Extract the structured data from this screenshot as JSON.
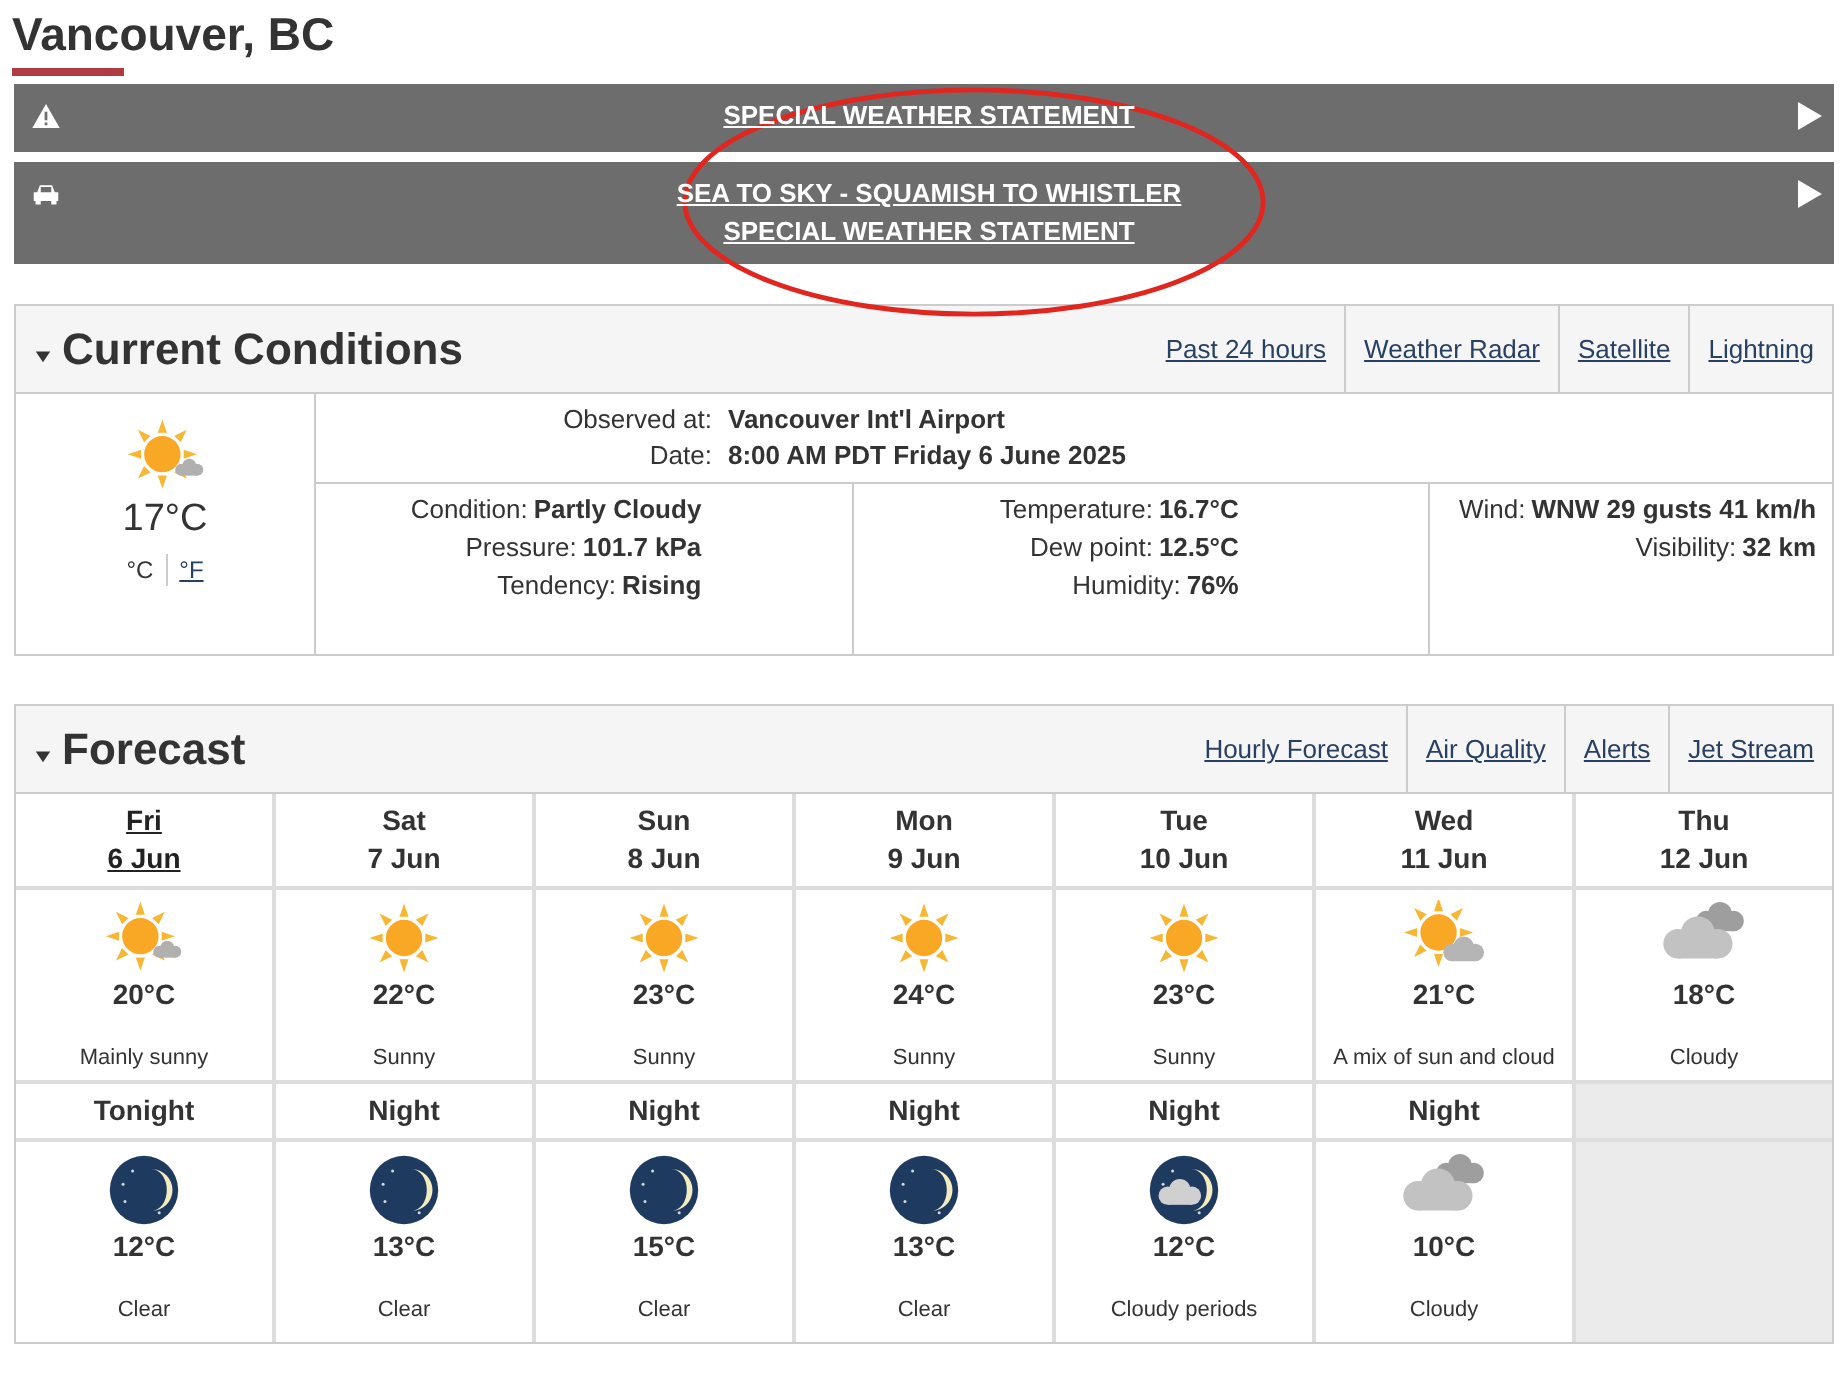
{
  "page_title": "Vancouver, BC",
  "alerts": [
    {
      "kind": "warning",
      "lines": [
        "SPECIAL WEATHER STATEMENT"
      ]
    },
    {
      "kind": "car",
      "lines": [
        "SEA TO SKY - SQUAMISH TO WHISTLER",
        "SPECIAL WEATHER STATEMENT"
      ]
    }
  ],
  "annotation": {
    "kind": "ellipse"
  },
  "current_conditions": {
    "title": "Current Conditions",
    "links": [
      "Past 24 hours",
      "Weather Radar",
      "Satellite",
      "Lightning"
    ],
    "kind": "mainly-sunny",
    "temperature": "17°C",
    "units": [
      {
        "label": "°C",
        "selected": true
      },
      {
        "label": "°F",
        "selected": false
      }
    ],
    "observation": [
      {
        "label": "Observed at:",
        "value": "Vancouver Int'l Airport"
      },
      {
        "label": "Date:",
        "value": "8:00 AM PDT Friday 6 June 2025"
      }
    ],
    "columns": [
      [
        {
          "label": "Condition:",
          "value": "Partly Cloudy"
        },
        {
          "label": "Pressure:",
          "value": "101.7 kPa"
        },
        {
          "label": "Tendency:",
          "value": "Rising"
        }
      ],
      [
        {
          "label": "Temperature:",
          "value": "16.7°C"
        },
        {
          "label": "Dew point:",
          "value": "12.5°C"
        },
        {
          "label": "Humidity:",
          "value": "76%"
        }
      ],
      [
        {
          "label": "Wind:",
          "value": "WNW 29 gusts 41 km/h"
        },
        {
          "label": "Visibility:",
          "value": "32 km"
        }
      ]
    ]
  },
  "forecast": {
    "title": "Forecast",
    "links": [
      "Hourly Forecast",
      "Air Quality",
      "Alerts",
      "Jet Stream"
    ],
    "days": [
      {
        "day": "Fri",
        "date": "6 Jun",
        "selected": true,
        "kind": "mainly-sunny",
        "temperature": "20°C",
        "summary": "Mainly sunny"
      },
      {
        "day": "Sat",
        "date": "7 Jun",
        "selected": false,
        "kind": "sunny",
        "temperature": "22°C",
        "summary": "Sunny"
      },
      {
        "day": "Sun",
        "date": "8 Jun",
        "selected": false,
        "kind": "sunny",
        "temperature": "23°C",
        "summary": "Sunny"
      },
      {
        "day": "Mon",
        "date": "9 Jun",
        "selected": false,
        "kind": "sunny",
        "temperature": "24°C",
        "summary": "Sunny"
      },
      {
        "day": "Tue",
        "date": "10 Jun",
        "selected": false,
        "kind": "sunny",
        "temperature": "23°C",
        "summary": "Sunny"
      },
      {
        "day": "Wed",
        "date": "11 Jun",
        "selected": false,
        "kind": "mix",
        "temperature": "21°C",
        "summary": "A mix of sun and cloud"
      },
      {
        "day": "Thu",
        "date": "12 Jun",
        "selected": false,
        "kind": "cloudy",
        "temperature": "18°C",
        "summary": "Cloudy"
      }
    ],
    "nights": [
      {
        "label": "Tonight",
        "kind": "clear-night",
        "temperature": "12°C",
        "summary": "Clear"
      },
      {
        "label": "Night",
        "kind": "clear-night",
        "temperature": "13°C",
        "summary": "Clear"
      },
      {
        "label": "Night",
        "kind": "clear-night",
        "temperature": "15°C",
        "summary": "Clear"
      },
      {
        "label": "Night",
        "kind": "clear-night",
        "temperature": "13°C",
        "summary": "Clear"
      },
      {
        "label": "Night",
        "kind": "cloudy-night",
        "temperature": "12°C",
        "summary": "Cloudy periods"
      },
      {
        "label": "Night",
        "kind": "cloudy",
        "temperature": "10°C",
        "summary": "Cloudy"
      }
    ]
  }
}
